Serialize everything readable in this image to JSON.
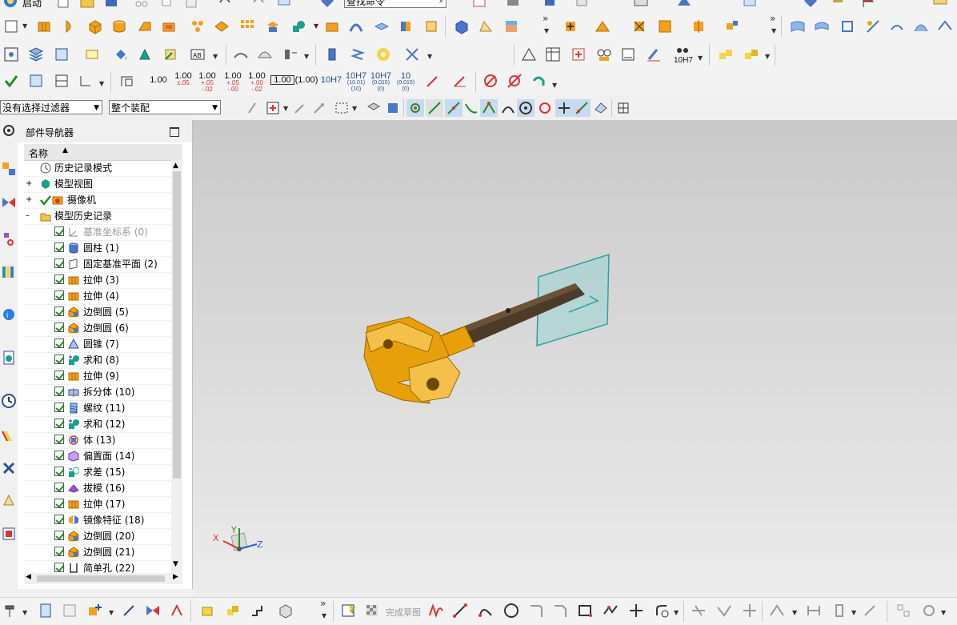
{
  "top_toolbar": {
    "start_label": "启动",
    "command_search_value": "查找命令",
    "overflow_glyph": "»"
  },
  "dim_toolbar": {
    "values": [
      {
        "main": "1.00",
        "sub": ""
      },
      {
        "main": "1.00",
        "sub": "±.05"
      },
      {
        "main": "1.00",
        "sub": "+.05 -.02"
      },
      {
        "main": "1.00",
        "sub": "+.05 -.00"
      },
      {
        "main": "1.00",
        "sub": "+.00 -.02"
      },
      {
        "main": "1.00",
        "sub": ""
      },
      {
        "main": "(1.00)",
        "sub": ""
      },
      {
        "main": "10H7",
        "sub": ""
      },
      {
        "main": "10H7",
        "sub": "(10.01) (10)"
      },
      {
        "main": "10H7",
        "sub": "(0.015) (0)"
      },
      {
        "main": "10",
        "sub": "(0.015) (0)"
      }
    ],
    "tolerance_label": "10H7"
  },
  "selection_bar": {
    "filter_value": "没有选择过滤器",
    "scope_value": "整个装配"
  },
  "navigator": {
    "title": "部件导航器",
    "column_name": "名称",
    "top_nodes": [
      {
        "label": "历史记录模式",
        "icon": "clock-icon"
      },
      {
        "label": "模型视图",
        "icon": "model-view-icon"
      },
      {
        "label": "摄像机",
        "icon": "camera-icon"
      },
      {
        "label": "模型历史记录",
        "icon": "folder-icon"
      }
    ],
    "features": [
      {
        "label": "基准坐标系 (0)",
        "icon": "datum-csys-icon",
        "dim": true
      },
      {
        "label": "圆柱 (1)",
        "icon": "cylinder-icon"
      },
      {
        "label": "固定基准平面 (2)",
        "icon": "datum-plane-icon"
      },
      {
        "label": "拉伸 (3)",
        "icon": "extrude-icon"
      },
      {
        "label": "拉伸 (4)",
        "icon": "extrude-icon"
      },
      {
        "label": "边倒圆 (5)",
        "icon": "edge-blend-icon"
      },
      {
        "label": "边倒圆 (6)",
        "icon": "edge-blend-icon"
      },
      {
        "label": "圆锥 (7)",
        "icon": "cone-icon"
      },
      {
        "label": "求和 (8)",
        "icon": "unite-icon"
      },
      {
        "label": "拉伸 (9)",
        "icon": "extrude-icon"
      },
      {
        "label": "拆分体 (10)",
        "icon": "split-body-icon"
      },
      {
        "label": "螺纹 (11)",
        "icon": "thread-icon"
      },
      {
        "label": "求和 (12)",
        "icon": "unite-icon"
      },
      {
        "label": "体 (13)",
        "icon": "body-icon"
      },
      {
        "label": "偏置面 (14)",
        "icon": "offset-face-icon"
      },
      {
        "label": "求差 (15)",
        "icon": "subtract-icon"
      },
      {
        "label": "拔模 (16)",
        "icon": "draft-icon"
      },
      {
        "label": "拉伸 (17)",
        "icon": "extrude-icon"
      },
      {
        "label": "镜像特征 (18)",
        "icon": "mirror-feature-icon"
      },
      {
        "label": "边倒圆 (20)",
        "icon": "edge-blend-icon"
      },
      {
        "label": "边倒圆 (21)",
        "icon": "edge-blend-icon"
      },
      {
        "label": "简单孔 (22)",
        "icon": "simple-hole-icon"
      }
    ]
  },
  "viewport": {
    "triad_labels": {
      "x": "X",
      "y": "Y",
      "z": "Z"
    },
    "model_color": "#e8a00a",
    "plane_color": "#5fc9c9"
  },
  "bottom_toolbar": {
    "finish_sketch_label": "完成草图"
  },
  "colors": {
    "accent_green": "#1e8f1e",
    "viewport_top": "#c9c9c9",
    "viewport_bottom": "#ececec"
  }
}
